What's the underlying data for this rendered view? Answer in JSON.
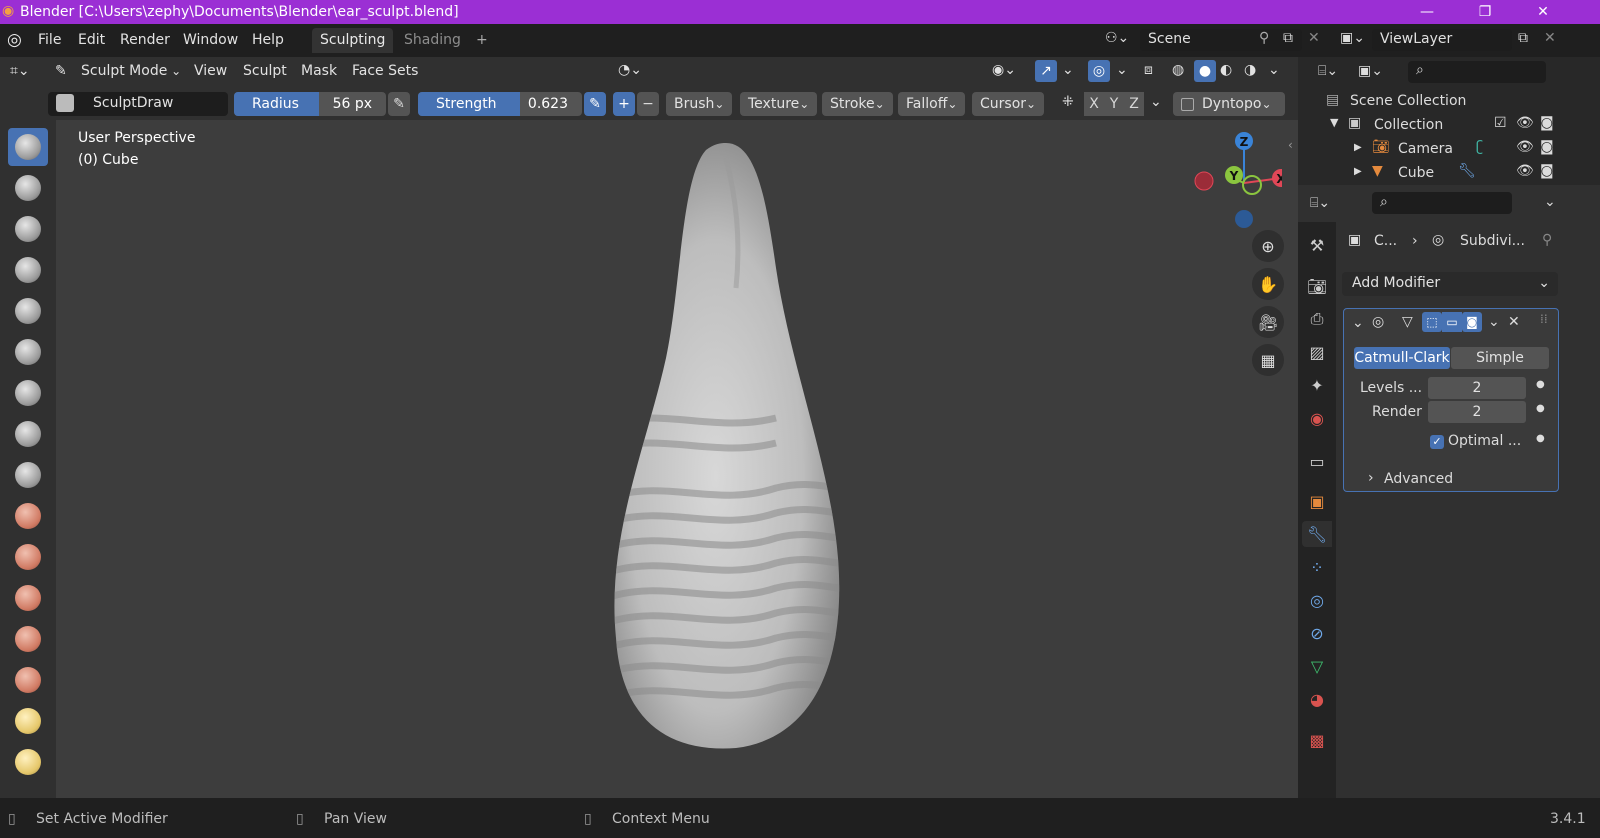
{
  "window": {
    "title": "Blender [C:\\Users\\zephy\\Documents\\Blender\\ear_sculpt.blend]",
    "minimize": "—",
    "maximize": "❐",
    "close": "✕"
  },
  "menu": {
    "items": [
      "File",
      "Edit",
      "Render",
      "Window",
      "Help"
    ],
    "tabs": [
      "Sculpting",
      "Shading"
    ],
    "add_tab": "+"
  },
  "scene": {
    "name": "Scene",
    "view_layer": "ViewLayer"
  },
  "header": {
    "mode": "Sculpt Mode",
    "menus": [
      "View",
      "Sculpt",
      "Mask",
      "Face Sets"
    ]
  },
  "tool_settings": {
    "brush_name": "SculptDraw",
    "radius_label": "Radius",
    "radius_value": "56 px",
    "radius_fill": 0.56,
    "strength_label": "Strength",
    "strength_value": "0.623",
    "strength_fill": 0.623,
    "plus": "+",
    "minus": "−",
    "dropdowns": [
      "Brush",
      "Texture",
      "Stroke",
      "Falloff",
      "Cursor"
    ],
    "axes": [
      "X",
      "Y",
      "Z"
    ],
    "dyntopo": "Dyntopo"
  },
  "viewport": {
    "perspective": "User Perspective",
    "object": "(0) Cube",
    "gizmo": {
      "z": "Z",
      "y": "Y",
      "x": "X"
    }
  },
  "outliner": {
    "root": "Scene Collection",
    "collection": "Collection",
    "items": [
      "Camera",
      "Cube"
    ]
  },
  "properties": {
    "breadcrumb_object": "C...",
    "breadcrumb_modifier": "Subdivi...",
    "add_modifier": "Add Modifier",
    "subdiv_modes": [
      "Catmull-Clark",
      "Simple"
    ],
    "levels_label": "Levels ...",
    "levels_value": "2",
    "render_label": "Render",
    "render_value": "2",
    "optimal_label": "Optimal ...",
    "optimal_checked": true,
    "advanced": "Advanced"
  },
  "status": {
    "left": "Set Active Modifier",
    "middle": "Pan View",
    "right": "Context Menu",
    "version": "3.4.1"
  },
  "colors": {
    "accent": "#4772b3",
    "titlebar": "#9b2fd4",
    "x_axis": "#e04757",
    "y_axis": "#8bc53f",
    "z_axis": "#3a84d8"
  }
}
